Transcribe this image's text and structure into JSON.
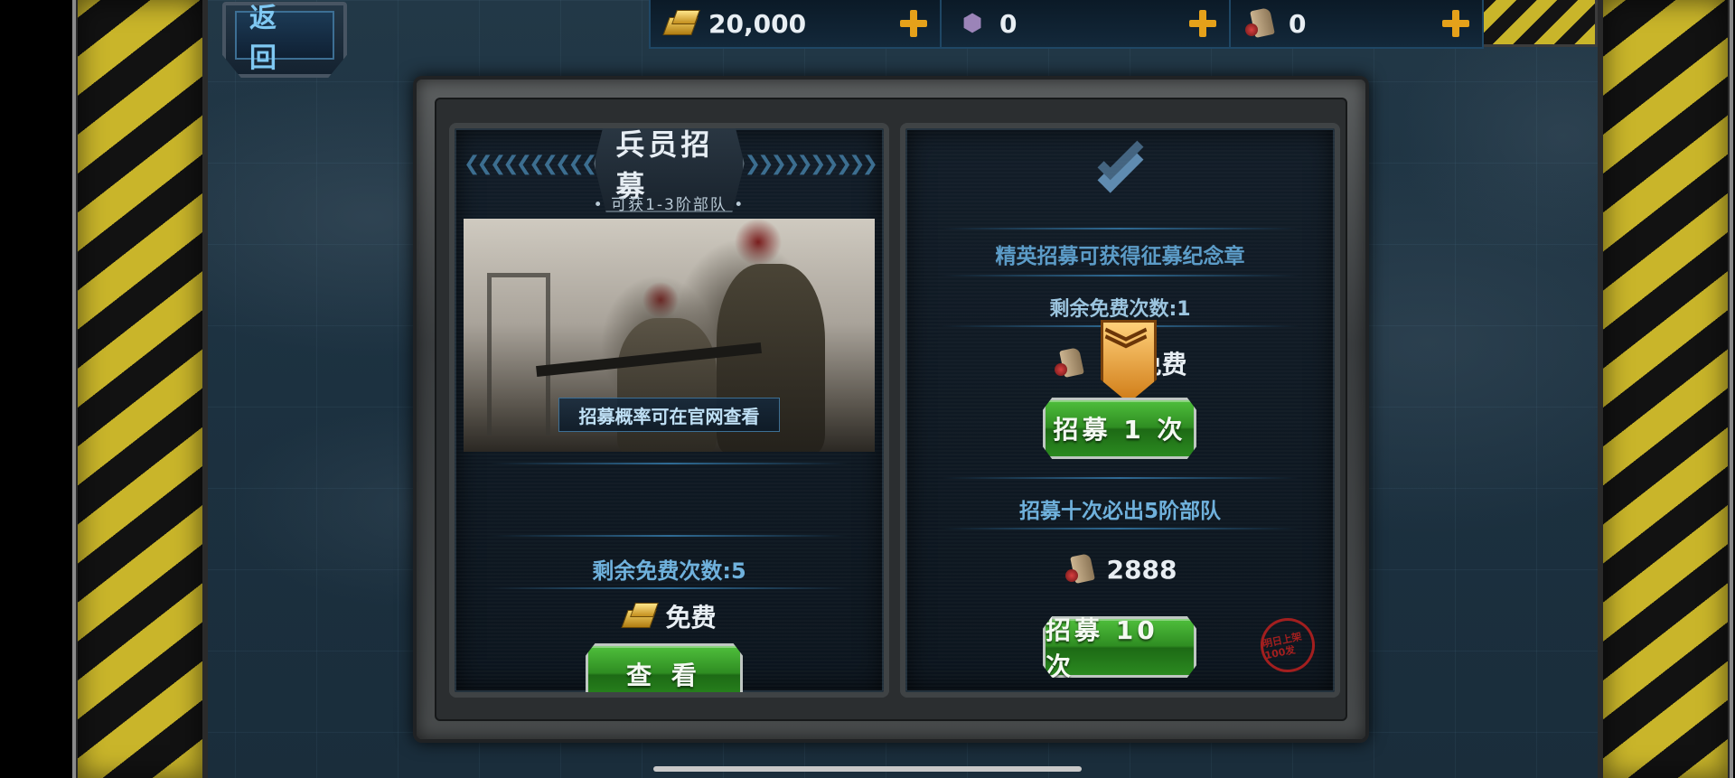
{
  "header": {
    "back_label": "返 回",
    "resources": [
      {
        "name": "gold",
        "icon": "gold-bar-icon",
        "value": "20,000"
      },
      {
        "name": "gem",
        "icon": "gem-icon",
        "value": "0"
      },
      {
        "name": "recruit-scroll",
        "icon": "scroll-icon",
        "value": "0"
      }
    ]
  },
  "left_panel": {
    "title": "兵员招募",
    "subtitle": "• 可获1-3阶部队 •",
    "image_caption": "招募概率可在官网查看",
    "remaining_free": "剩余免费次数:5",
    "cost_label": "免费",
    "view_button": "查  看"
  },
  "right_panel": {
    "elite_note": "精英招募可获得征募纪念章",
    "remaining_free": "剩余免费次数:1",
    "cost_label": "免费",
    "recruit_once_button": "招募 1 次",
    "ten_note": "招募十次必出5阶部队",
    "ten_cost": "2888",
    "recruit_ten_button": "招募 10 次",
    "seal_text": "明日上架 100发"
  },
  "colors": {
    "accent_blue": "#5c9cc8",
    "button_green": "#2f8d22",
    "hazard_yellow": "#c9b52a",
    "plus_orange": "#e5a11a"
  }
}
